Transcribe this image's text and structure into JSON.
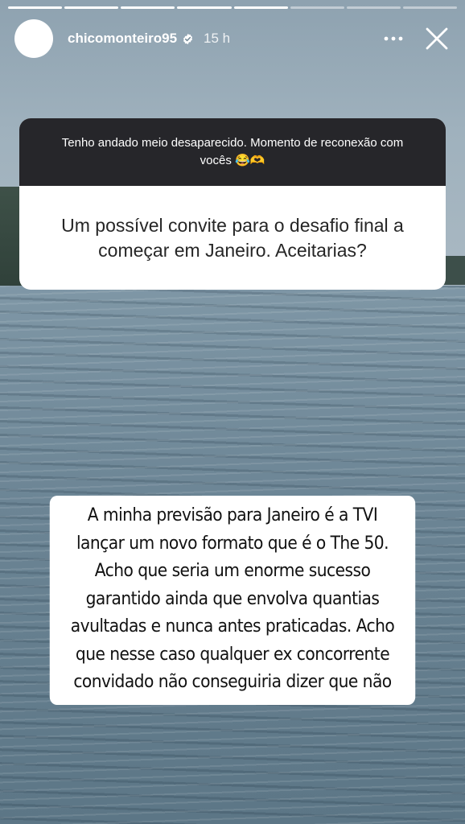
{
  "story": {
    "progress": {
      "segments_total": 8,
      "segments_done": 5
    },
    "username": "chicomonteiro95",
    "verified_icon": "verified-badge-icon",
    "time_ago": "15 h",
    "more_icon": "more-options-icon",
    "close_icon": "close-icon"
  },
  "question_sticker": {
    "prompt": "Tenho andado meio desaparecido. Momento de reconexão com vocês 😂🫶",
    "question": "Um possível convite para o desafio final a começar em Janeiro. Aceitarias?"
  },
  "answer": {
    "lines": [
      "A minha previsão para Janeiro é a TVI",
      "lançar um novo formato que é o The 50.",
      "Acho que seria um enorme sucesso",
      "garantido ainda que envolva quantias",
      "avultadas e nunca antes praticadas. Acho",
      "que nesse caso qualquer ex concorrente",
      "convidado não conseguiria dizer que não"
    ]
  },
  "colors": {
    "sticker_header": "#26262a",
    "sticker_body": "#ffffff",
    "text_dark": "#111111"
  }
}
